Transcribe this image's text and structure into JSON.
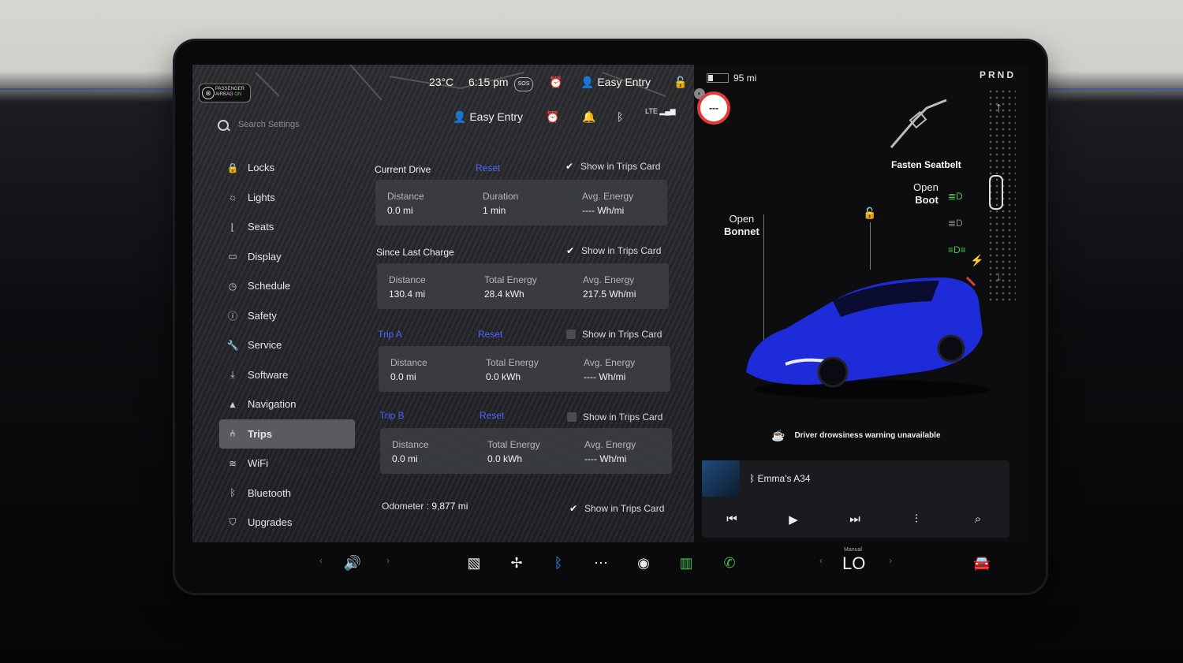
{
  "status": {
    "airbag_line1": "PASSENGER",
    "airbag_line2": "AIRBAG",
    "airbag_state": "ON",
    "temperature": "23°C",
    "time": "6:15 pm",
    "sos": "SOS",
    "profile": "Easy Entry",
    "profile_sub": "Easy Entry",
    "lte": "LTE"
  },
  "search": {
    "placeholder": "Search Settings"
  },
  "sidebar": {
    "items": [
      {
        "label": "Locks",
        "icon": "lock-icon"
      },
      {
        "label": "Lights",
        "icon": "sun-icon"
      },
      {
        "label": "Seats",
        "icon": "seat-icon"
      },
      {
        "label": "Display",
        "icon": "display-icon"
      },
      {
        "label": "Schedule",
        "icon": "clock-icon"
      },
      {
        "label": "Safety",
        "icon": "info-icon"
      },
      {
        "label": "Service",
        "icon": "wrench-icon"
      },
      {
        "label": "Software",
        "icon": "download-icon"
      },
      {
        "label": "Navigation",
        "icon": "navigation-icon"
      },
      {
        "label": "Trips",
        "icon": "trips-icon"
      },
      {
        "label": "WiFi",
        "icon": "wifi-icon"
      },
      {
        "label": "Bluetooth",
        "icon": "bluetooth-icon"
      },
      {
        "label": "Upgrades",
        "icon": "bag-icon"
      }
    ],
    "active": "Trips"
  },
  "trips": {
    "show_label": "Show in Trips Card",
    "reset_label": "Reset",
    "current": {
      "title": "Current Drive",
      "c1_label": "Distance",
      "c1_value": "0.0 mi",
      "c2_label": "Duration",
      "c2_value": "1 min",
      "c3_label": "Avg. Energy",
      "c3_value": "---- Wh/mi",
      "checked": true
    },
    "since_charge": {
      "title": "Since Last Charge",
      "c1_label": "Distance",
      "c1_value": "130.4 mi",
      "c2_label": "Total Energy",
      "c2_value": "28.4 kWh",
      "c3_label": "Avg. Energy",
      "c3_value": "217.5 Wh/mi",
      "checked": true
    },
    "trip_a": {
      "title": "Trip A",
      "c1_label": "Distance",
      "c1_value": "0.0 mi",
      "c2_label": "Total Energy",
      "c2_value": "0.0 kWh",
      "c3_label": "Avg. Energy",
      "c3_value": "---- Wh/mi",
      "checked": false
    },
    "trip_b": {
      "title": "Trip B",
      "c1_label": "Distance",
      "c1_value": "0.0 mi",
      "c2_label": "Total Energy",
      "c2_value": "0.0 kWh",
      "c3_label": "Avg. Energy",
      "c3_value": "---- Wh/mi",
      "checked": false
    },
    "odometer_label": "Odometer :",
    "odometer_value": "9,877 mi"
  },
  "vehicle": {
    "range": "95 mi",
    "gear": "PRND",
    "fasten_seatbelt": "Fasten Seatbelt",
    "open_boot_1": "Open",
    "open_boot_2": "Boot",
    "open_bonnet_1": "Open",
    "open_bonnet_2": "Bonnet",
    "drowsiness": "Driver drowsiness warning unavailable",
    "speed_limit": "---",
    "car_color": "#1e2bd8"
  },
  "media": {
    "track": "Emma's A34"
  },
  "dock": {
    "climate_mode": "Manual",
    "climate_temp": "LO"
  },
  "colors": {
    "accent_blue": "#4f63ff",
    "alert_orange": "#ff7a3a",
    "light_green": "#48c548"
  }
}
